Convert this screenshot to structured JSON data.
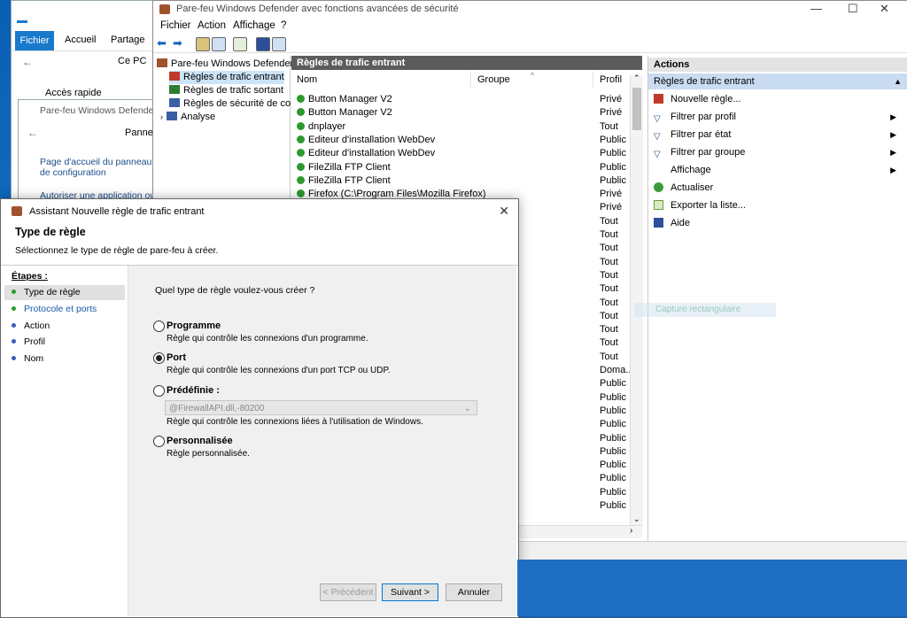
{
  "explorer": {
    "tabs": [
      "Fichier",
      "Accueil",
      "Partage"
    ],
    "address": "Ce PC",
    "quick_access": "Accès rapide"
  },
  "control_panel": {
    "title": "Pare-feu Windows Defender",
    "address": "Panneau",
    "link1": "Page d'accueil du panneau de configuration",
    "link2": "Autoriser une application ou"
  },
  "mmc": {
    "title": "Pare-feu Windows Defender avec fonctions avancées de sécurité",
    "menu": [
      "Fichier",
      "Action",
      "Affichage",
      "?"
    ],
    "tree": {
      "root": "Pare-feu Windows Defender av",
      "items": [
        "Règles de trafic entrant",
        "Règles de trafic sortant",
        "Règles de sécurité de conne",
        "Analyse"
      ]
    },
    "center": {
      "header": "Règles de trafic entrant",
      "columns": {
        "name": "Nom",
        "group": "Groupe",
        "profile": "Profil"
      },
      "rows": [
        {
          "name": "Button Manager V2",
          "profile": "Privé"
        },
        {
          "name": "Button Manager V2",
          "profile": "Privé"
        },
        {
          "name": "dnplayer",
          "profile": "Tout"
        },
        {
          "name": "Editeur d'installation WebDev",
          "profile": "Public"
        },
        {
          "name": "Editeur d'installation WebDev",
          "profile": "Public"
        },
        {
          "name": "FileZilla FTP Client",
          "profile": "Public"
        },
        {
          "name": "FileZilla FTP Client",
          "profile": "Public"
        },
        {
          "name": "Firefox (C:\\Program Files\\Mozilla Firefox)",
          "profile": "Privé"
        }
      ],
      "extra_profiles": [
        "Privé",
        "Tout",
        "Tout",
        "Tout",
        "Tout",
        "Tout",
        "Tout",
        "Tout",
        "Tout",
        "Tout",
        "Tout",
        "Tout",
        "Doma...",
        "Public",
        "Public",
        "Public",
        "Public",
        "Public",
        "Public",
        "Public",
        "Public",
        "Public",
        "Public"
      ]
    },
    "actions": {
      "header": "Actions",
      "sub": "Règles de trafic entrant",
      "items": [
        "Nouvelle règle...",
        "Filtrer par profil",
        "Filtrer par état",
        "Filtrer par groupe",
        "Affichage",
        "Actualiser",
        "Exporter la liste...",
        "Aide"
      ]
    },
    "ghost": "Capture rectangulaire"
  },
  "wizard": {
    "title": "Assistant Nouvelle règle de trafic entrant",
    "heading": "Type de règle",
    "subheading": "Sélectionnez le type de règle de pare-feu à créer.",
    "steps_label": "Étapes :",
    "steps": [
      "Type de règle",
      "Protocole et ports",
      "Action",
      "Profil",
      "Nom"
    ],
    "question": "Quel type de règle voulez-vous créer ?",
    "options": [
      {
        "label": "Programme",
        "desc": "Règle qui contrôle les connexions d'un programme."
      },
      {
        "label": "Port",
        "desc": "Règle qui contrôle les connexions d'un port TCP ou UDP."
      },
      {
        "label": "Prédéfinie :",
        "desc": "Règle qui contrôle les connexions liées à l'utilisation de Windows."
      },
      {
        "label": "Personnalisée",
        "desc": "Règle personnalisée."
      }
    ],
    "predefined_value": "@FirewallAPI.dll,-80200",
    "buttons": {
      "prev": "< Précédent",
      "next": "Suivant >",
      "cancel": "Annuler"
    }
  },
  "colors": {
    "accent": "#0078d7",
    "ok": "#2c9a2c",
    "header_dark": "#5c5c5c"
  }
}
